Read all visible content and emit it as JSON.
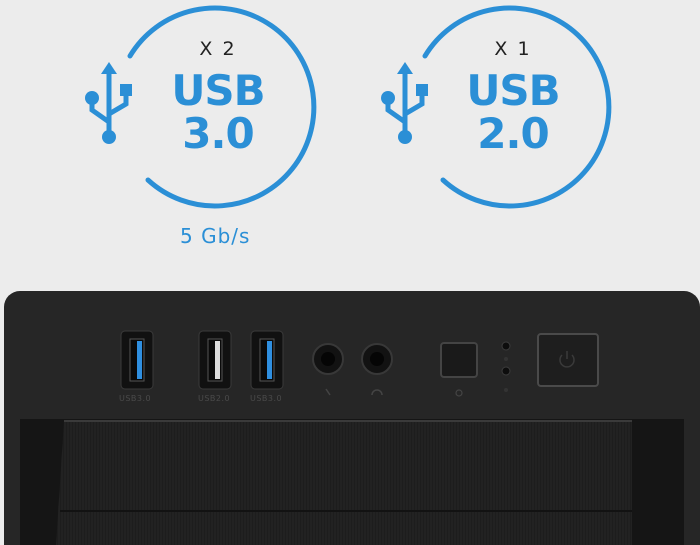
{
  "colors": {
    "accent": "#2b8fd6",
    "case": "#262626",
    "background": "#ececec"
  },
  "badges": [
    {
      "count": "X 2",
      "line1": "USB",
      "line2": "3.0",
      "speed": "5 Gb/s",
      "icon": "usb-icon"
    },
    {
      "count": "X 1",
      "line1": "USB",
      "line2": "2.0",
      "icon": "usb-icon"
    }
  ],
  "front_panel": {
    "ports": [
      {
        "label": "USB3.0",
        "icon": "usb3-port"
      },
      {
        "label": "USB2.0",
        "icon": "usb2-port"
      },
      {
        "label": "USB3.0",
        "icon": "usb3-port"
      }
    ],
    "audio": [
      {
        "icon": "microphone-jack-icon"
      },
      {
        "icon": "headphone-jack-icon"
      }
    ],
    "buttons": [
      {
        "icon": "reset-button"
      },
      {
        "icon": "power-button"
      }
    ],
    "leds": [
      {
        "icon": "power-led"
      },
      {
        "icon": "hdd-led"
      }
    ]
  }
}
